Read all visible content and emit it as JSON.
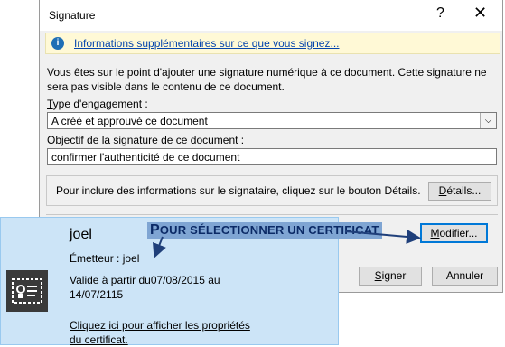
{
  "dialog": {
    "title": "Signature",
    "help": "?",
    "close": "✕",
    "info_link": "Informations supplémentaires sur ce que vous signez...",
    "intro": "Vous êtes sur le point d'ajouter une signature numérique à ce document. Cette signature ne sera pas visible dans le contenu de ce document.",
    "commitment_label_u": "T",
    "commitment_label_rest": "ype d'engagement :",
    "commitment_value": "A créé et approuvé ce document",
    "purpose_label_u": "O",
    "purpose_label_rest": "bjectif de la signature de ce document :",
    "purpose_value": "confirmer l'authenticité de ce document",
    "details_text": "Pour inclure des informations sur le signataire, cliquez sur le bouton Détails.",
    "details_button_u": "D",
    "details_button_rest": "étails...",
    "modify_button_u": "M",
    "modify_button_rest": "odifier...",
    "sign_button_u": "S",
    "sign_button_rest": "igner",
    "cancel_button": "Annuler"
  },
  "certificate_popup": {
    "name": "joel",
    "issuer": "Émetteur : joel",
    "valid": "Valide à partir du07/08/2015 au 14/07/2115",
    "properties_link": "Cliquez ici pour afficher les propriétés du certificat."
  },
  "annotation": {
    "first_letter": "P",
    "rest": "OUR SÉLECTIONNER UN CERTIFICAT"
  },
  "colors": {
    "info_bar": "#fff9d6",
    "popup_bg": "#cce4f7",
    "callout_bg": "#7fa5d3",
    "callout_text": "#0b2a66",
    "default_button_border": "#0078d7"
  }
}
